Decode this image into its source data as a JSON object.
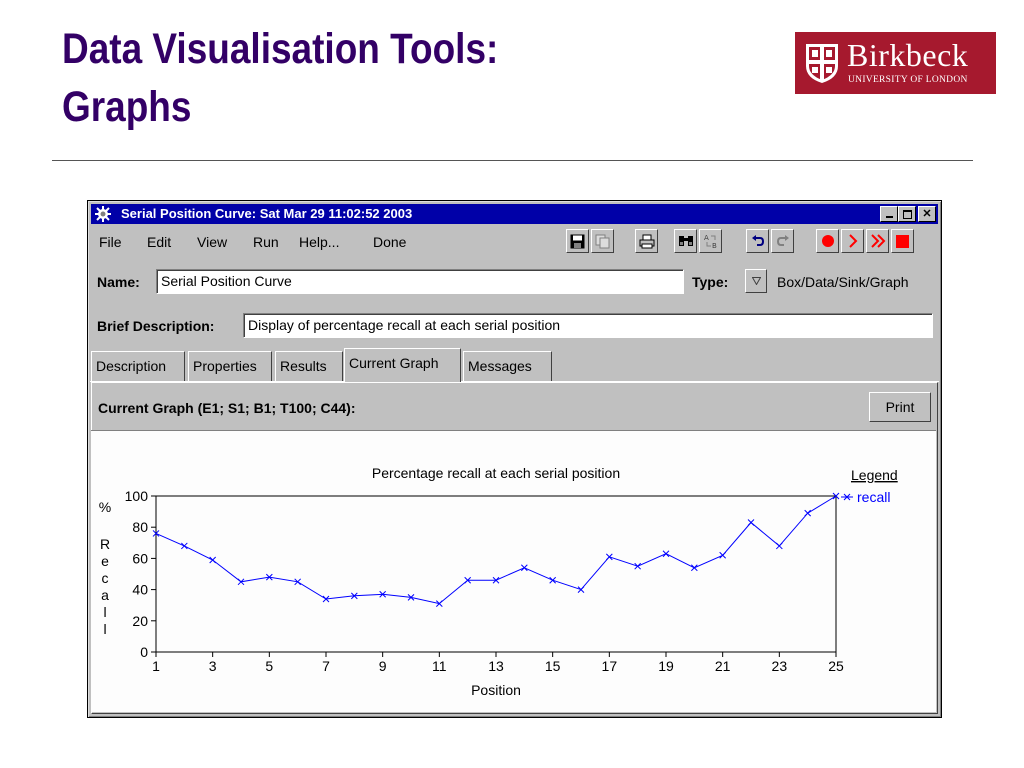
{
  "slide": {
    "title_line1": "Data Visualisation Tools:",
    "title_line2": "Graphs"
  },
  "logo": {
    "name": "Birkbeck",
    "sub": "UNIVERSITY OF LONDON",
    "color": "#a6192e"
  },
  "window": {
    "title": "Serial Position Curve: Sat Mar 29 11:02:52 2003",
    "menu": [
      "File",
      "Edit",
      "View",
      "Run",
      "Help...",
      "Done"
    ],
    "toolbar_icons": [
      "save-icon",
      "copy-icon",
      "print-icon",
      "find-icon",
      "replace-icon",
      "undo-icon",
      "redo-icon",
      "record-icon",
      "step-icon",
      "run-icon",
      "stop-icon"
    ],
    "name_label": "Name:",
    "name_value": "Serial Position Curve",
    "type_label": "Type:",
    "type_value": "Box/Data/Sink/Graph",
    "desc_label": "Brief Description:",
    "desc_value": "Display of percentage recall at each serial position",
    "tabs": [
      "Description",
      "Properties",
      "Results",
      "Current Graph",
      "Messages"
    ],
    "active_tab": "Current Graph",
    "graph_header": "Current Graph (E1; S1; B1; T100; C44):",
    "print_label": "Print"
  },
  "chart_data": {
    "type": "line",
    "title": "Percentage recall at each serial position",
    "xlabel": "Position",
    "ylabel_top": "%",
    "ylabel_chars": [
      "R",
      "e",
      "c",
      "a",
      "l",
      "l"
    ],
    "legend_title": "Legend",
    "legend_placement": "right",
    "xlim": [
      1,
      25
    ],
    "ylim": [
      0,
      100
    ],
    "x_ticks": [
      1,
      3,
      5,
      7,
      9,
      11,
      13,
      15,
      17,
      19,
      21,
      23,
      25
    ],
    "y_ticks": [
      0,
      20,
      40,
      60,
      80,
      100
    ],
    "grid": false,
    "series": [
      {
        "name": "recall",
        "color": "#0000ff",
        "marker": "x",
        "x": [
          1,
          2,
          3,
          4,
          5,
          6,
          7,
          8,
          9,
          10,
          11,
          12,
          13,
          14,
          15,
          16,
          17,
          18,
          19,
          20,
          21,
          22,
          23,
          24,
          25
        ],
        "y": [
          76,
          68,
          59,
          45,
          48,
          45,
          34,
          36,
          37,
          35,
          31,
          46,
          46,
          54,
          46,
          40,
          61,
          55,
          63,
          54,
          62,
          83,
          68,
          89,
          100
        ]
      }
    ]
  }
}
